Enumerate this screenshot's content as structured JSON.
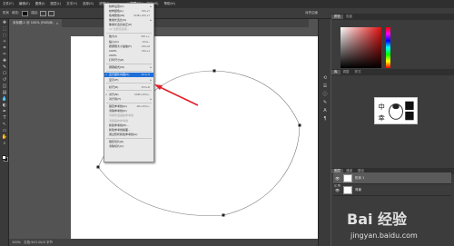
{
  "menubar": {
    "items": [
      "文件(F)",
      "编辑(E)",
      "图像(I)",
      "图层(L)",
      "文字(Y)",
      "选择(S)",
      "滤镜(T)",
      "3D(D)",
      "视图(V)",
      "窗口(W)",
      "帮助(H)"
    ],
    "active_index": 8
  },
  "optionsbar": {
    "tool_label": "形状",
    "fill_label": "填充:",
    "stroke_label": "描边:",
    "right_label": "对齐边缘"
  },
  "document_tab": {
    "title": "未标题-1 @ 100% (RGB/8)",
    "close": "×"
  },
  "statusbar": {
    "zoom": "100%",
    "doc_info": "文档:543.2K/0 字节"
  },
  "view_menu": {
    "rows": [
      {
        "label": "校样设置(U)",
        "shortcut": "",
        "submenu": true
      },
      {
        "label": "校样颜色(L)",
        "shortcut": "Ctrl+Y"
      },
      {
        "label": "色域警告(W)",
        "shortcut": "Shift+Ctrl+Y"
      },
      {
        "label": "像素长宽比(S)",
        "shortcut": "",
        "submenu": true
      },
      {
        "label": "像素长宽比校正(P)",
        "shortcut": ""
      },
      {
        "label": "32 位预览选项...",
        "shortcut": "",
        "disabled": true
      },
      {
        "sep": true
      },
      {
        "label": "放大(I)",
        "shortcut": "Ctrl++"
      },
      {
        "label": "缩小(O)",
        "shortcut": "Ctrl+-"
      },
      {
        "label": "按屏幕大小缩放(F)",
        "shortcut": "Ctrl+0"
      },
      {
        "label": "100%",
        "shortcut": "Ctrl+1"
      },
      {
        "label": "200%",
        "shortcut": ""
      },
      {
        "label": "打印尺寸(Z)",
        "shortcut": ""
      },
      {
        "sep": true
      },
      {
        "label": "屏幕模式(M)",
        "shortcut": "",
        "submenu": true
      },
      {
        "sep": true
      },
      {
        "label": "显示额外内容(X)",
        "shortcut": "Ctrl+H",
        "checked": true,
        "highlighted": true
      },
      {
        "label": "显示(H)",
        "shortcut": "",
        "submenu": true
      },
      {
        "sep": true
      },
      {
        "label": "标尺(R)",
        "shortcut": "Ctrl+R"
      },
      {
        "sep": true
      },
      {
        "label": "对齐(N)",
        "shortcut": "Shift+Ctrl+;",
        "checked": true
      },
      {
        "label": "对齐到(T)",
        "shortcut": "",
        "submenu": true
      },
      {
        "sep": true
      },
      {
        "label": "锁定参考线(G)",
        "shortcut": "Alt+Ctrl+;"
      },
      {
        "label": "清除参考线(D)",
        "shortcut": ""
      },
      {
        "label": "清除所选画板参考线",
        "shortcut": "",
        "disabled": true
      },
      {
        "label": "清除画布参考线",
        "shortcut": "",
        "disabled": true
      },
      {
        "label": "新建参考线(E)...",
        "shortcut": ""
      },
      {
        "label": "新建参考线版面...",
        "shortcut": ""
      },
      {
        "label": "通过形状新建参考线(A)",
        "shortcut": ""
      },
      {
        "sep": true
      },
      {
        "label": "锁定切片(K)",
        "shortcut": ""
      },
      {
        "label": "清除切片(C)",
        "shortcut": ""
      }
    ]
  },
  "panels": {
    "color_tabs": [
      "颜色",
      "色板"
    ],
    "adjust_tabs": [
      "库",
      "调整",
      "样式"
    ],
    "layer_tabs": [
      "图层",
      "通道",
      "路径"
    ],
    "kind_label": "类型",
    "blend_mode": "正常",
    "layers": [
      {
        "name": "形状 1",
        "selected": true
      },
      {
        "name": "背景"
      }
    ]
  },
  "toolbar": {
    "tools": [
      "move-tool",
      "marquee-tool",
      "lasso-tool",
      "quick-select-tool",
      "crop-tool",
      "eyedropper-tool",
      "healing-tool",
      "brush-tool",
      "stamp-tool",
      "history-brush-tool",
      "eraser-tool",
      "gradient-tool",
      "blur-tool",
      "dodge-tool",
      "pen-tool",
      "type-tool",
      "path-select-tool",
      "shape-tool",
      "hand-tool",
      "zoom-tool"
    ]
  },
  "watermark": {
    "main": "Bai 经验",
    "url": "jingyan.baidu.com"
  },
  "annotation": {
    "arrow_color": "#e0202a"
  }
}
